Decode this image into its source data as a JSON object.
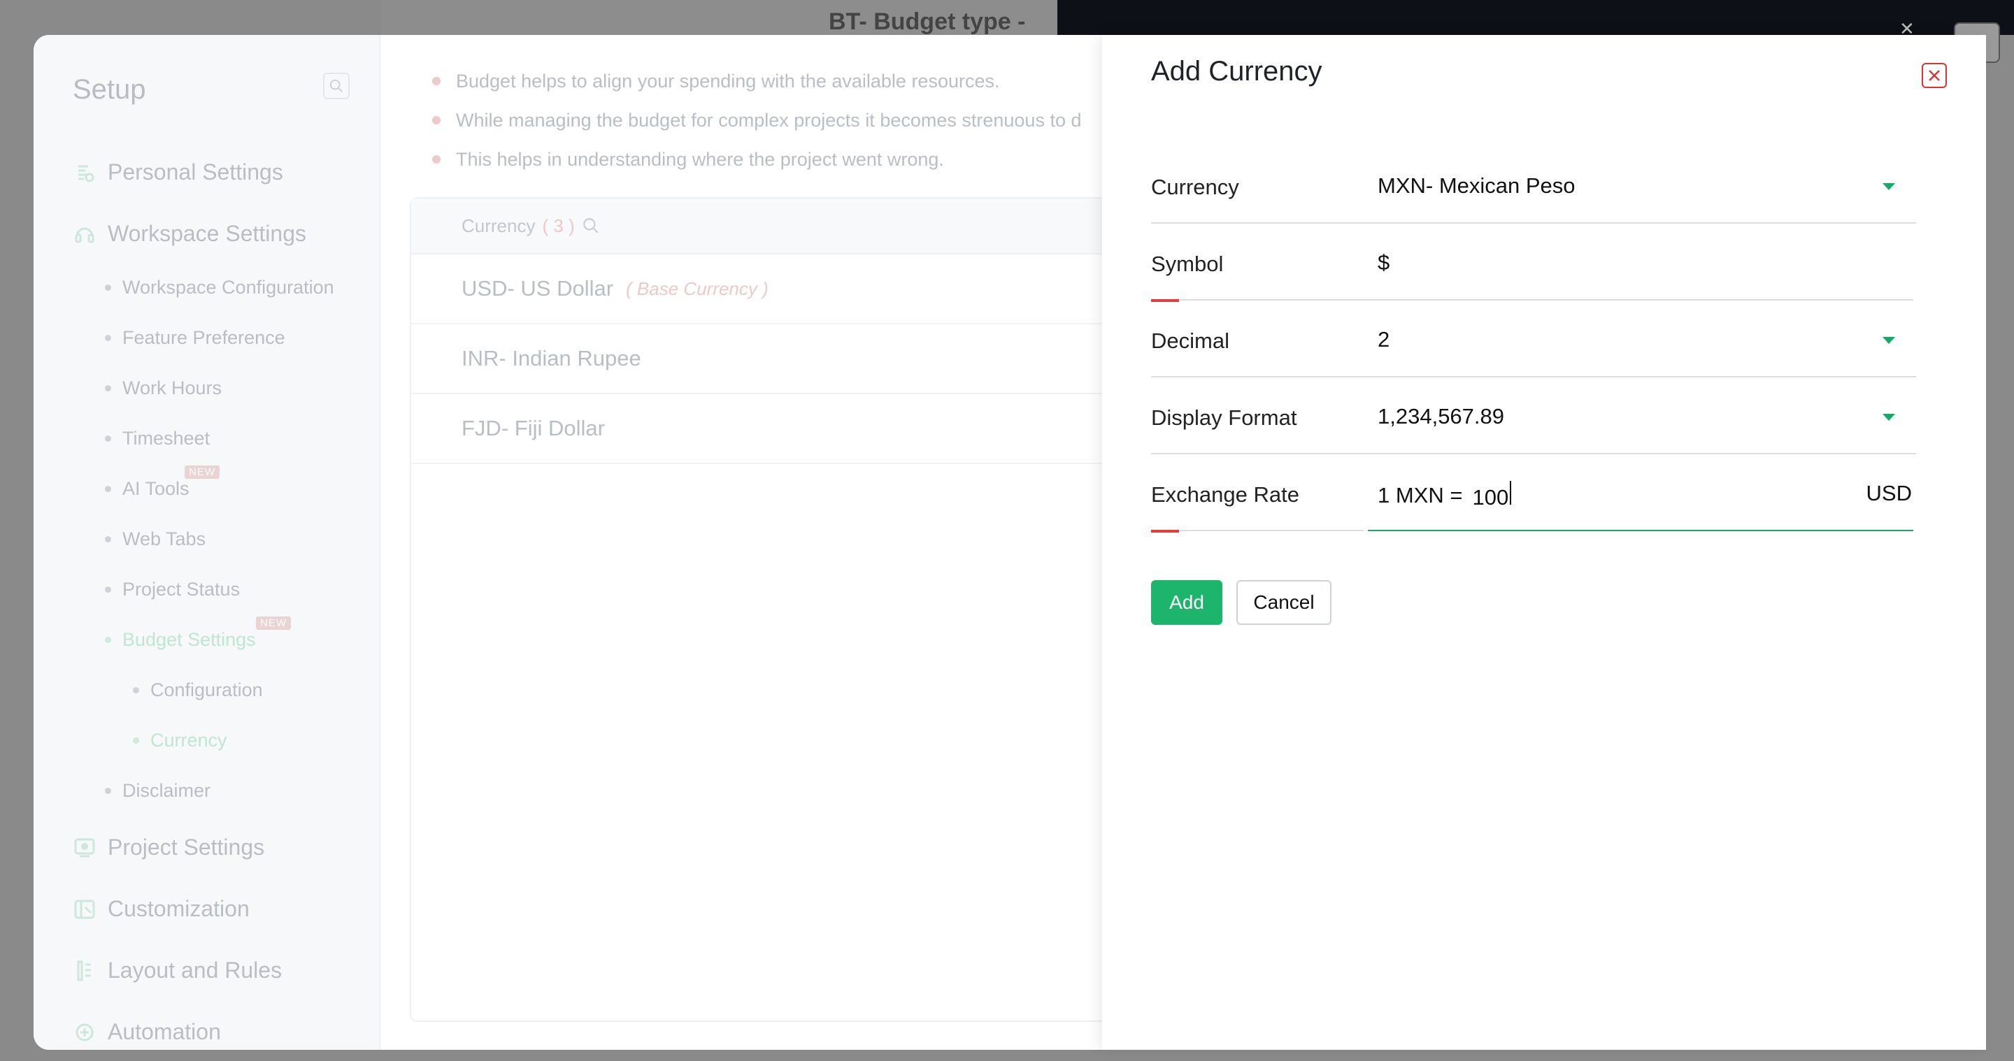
{
  "background": {
    "title": "BT- Budget type - Project Hours"
  },
  "setup": {
    "title": "Setup",
    "sections": [
      {
        "label": "Personal Settings"
      },
      {
        "label": "Workspace Settings"
      },
      {
        "label": "Project Settings"
      },
      {
        "label": "Customization"
      },
      {
        "label": "Layout and Rules"
      },
      {
        "label": "Automation"
      }
    ],
    "workspace_items": [
      {
        "label": "Workspace Configuration"
      },
      {
        "label": "Feature Preference"
      },
      {
        "label": "Work Hours"
      },
      {
        "label": "Timesheet"
      },
      {
        "label": "AI Tools"
      },
      {
        "label": "Web Tabs"
      },
      {
        "label": "Project Status"
      },
      {
        "label": "Budget Settings"
      },
      {
        "label": "Disclaimer"
      }
    ],
    "budget_items": [
      {
        "label": "Configuration"
      },
      {
        "label": "Currency"
      }
    ],
    "new_badge": "NEW"
  },
  "content": {
    "bullets": [
      "Budget helps to align your spending with the available resources.",
      "While managing the budget for complex projects it becomes strenuous to d",
      "This helps in understanding where the project went wrong."
    ],
    "currency_header": "Currency",
    "currency_count": "( 3 )",
    "currencies": [
      {
        "name": "USD- US Dollar",
        "tag": "( Base Currency )"
      },
      {
        "name": "INR- Indian Rupee",
        "tag": ""
      },
      {
        "name": "FJD- Fiji Dollar",
        "tag": ""
      }
    ]
  },
  "modal": {
    "title": "Add Currency",
    "fields": {
      "currency": {
        "label": "Currency",
        "value": "MXN- Mexican Peso"
      },
      "symbol": {
        "label": "Symbol",
        "value": "$"
      },
      "decimal": {
        "label": "Decimal",
        "value": "2"
      },
      "display_format": {
        "label": "Display Format",
        "value": "1,234,567.89"
      },
      "exchange_rate": {
        "label": "Exchange Rate",
        "prefix": "1 MXN =",
        "value": "100",
        "suffix": "USD"
      }
    },
    "add_label": "Add",
    "cancel_label": "Cancel"
  },
  "colors": {
    "accent": "#1db56c",
    "required": "#e53d3d"
  }
}
